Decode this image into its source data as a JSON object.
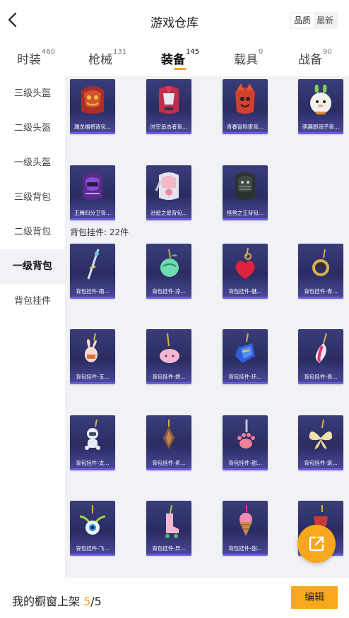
{
  "header": {
    "title": "游戏仓库",
    "sort": [
      "品质",
      "最新"
    ]
  },
  "tabs": [
    {
      "label": "时装",
      "count": "460"
    },
    {
      "label": "枪械",
      "count": "131"
    },
    {
      "label": "装备",
      "count": "145",
      "active": true
    },
    {
      "label": "载具",
      "count": "0"
    },
    {
      "label": "战备",
      "count": "90"
    }
  ],
  "sidebar": [
    "三级头盔",
    "二级头盔",
    "一级头盔",
    "三级背包",
    "二级背包",
    "一级背包",
    "背包挂件"
  ],
  "backpacks": [
    {
      "label": "瑞龙福将背包...",
      "icon": "dragon-backpack-icon"
    },
    {
      "label": "时空追击者背...",
      "icon": "chaser-backpack-icon"
    },
    {
      "label": "青春冒险家背...",
      "icon": "adventurer-backpack-icon"
    },
    {
      "label": "萌趣厨团子背...",
      "icon": "bunny-backpack-icon"
    },
    {
      "label": "王腾四分卫背...",
      "icon": "quarterback-backpack-icon"
    },
    {
      "label": "治愈之星背包...",
      "icon": "star-backpack-icon"
    },
    {
      "label": "怪兽之王背包...",
      "icon": "monster-backpack-icon"
    }
  ],
  "section": "背包挂件: 22件",
  "charms": [
    {
      "label": "背包挂件-雨...",
      "icon": "sword-charm-icon"
    },
    {
      "label": "背包挂件-凉...",
      "icon": "fruit-charm-icon"
    },
    {
      "label": "背包挂件-魅...",
      "icon": "heart-charm-icon"
    },
    {
      "label": "背包挂件-青...",
      "icon": "gold-charm-icon"
    },
    {
      "label": "背包挂件-玉...",
      "icon": "rabbit-charm-icon"
    },
    {
      "label": "背包挂件-娇...",
      "icon": "pink-blob-charm-icon"
    },
    {
      "label": "背包挂件-环...",
      "icon": "gem-charm-icon"
    },
    {
      "label": "背包挂件-青...",
      "icon": "feather-charm-icon"
    },
    {
      "label": "背包挂件-太...",
      "icon": "astronaut-charm-icon"
    },
    {
      "label": "背包挂件-炙...",
      "icon": "flame-charm-icon"
    },
    {
      "label": "背包挂件-甜...",
      "icon": "paw-charm-icon"
    },
    {
      "label": "背包挂件-筑...",
      "icon": "butterfly-charm-icon"
    },
    {
      "label": "背包挂件-飞...",
      "icon": "eye-charm-icon"
    },
    {
      "label": "背包挂件-异...",
      "icon": "skate-charm-icon"
    },
    {
      "label": "背包挂件-甜...",
      "icon": "icecream-charm-icon"
    },
    {
      "label": "",
      "icon": "red-charm-icon"
    }
  ],
  "bottom": {
    "prefix": "我的橱窗上架 ",
    "current": "5",
    "total": "/5",
    "edit": "编辑"
  },
  "colors": {
    "accent": "#f7a81b",
    "card": "#2a2c62"
  }
}
